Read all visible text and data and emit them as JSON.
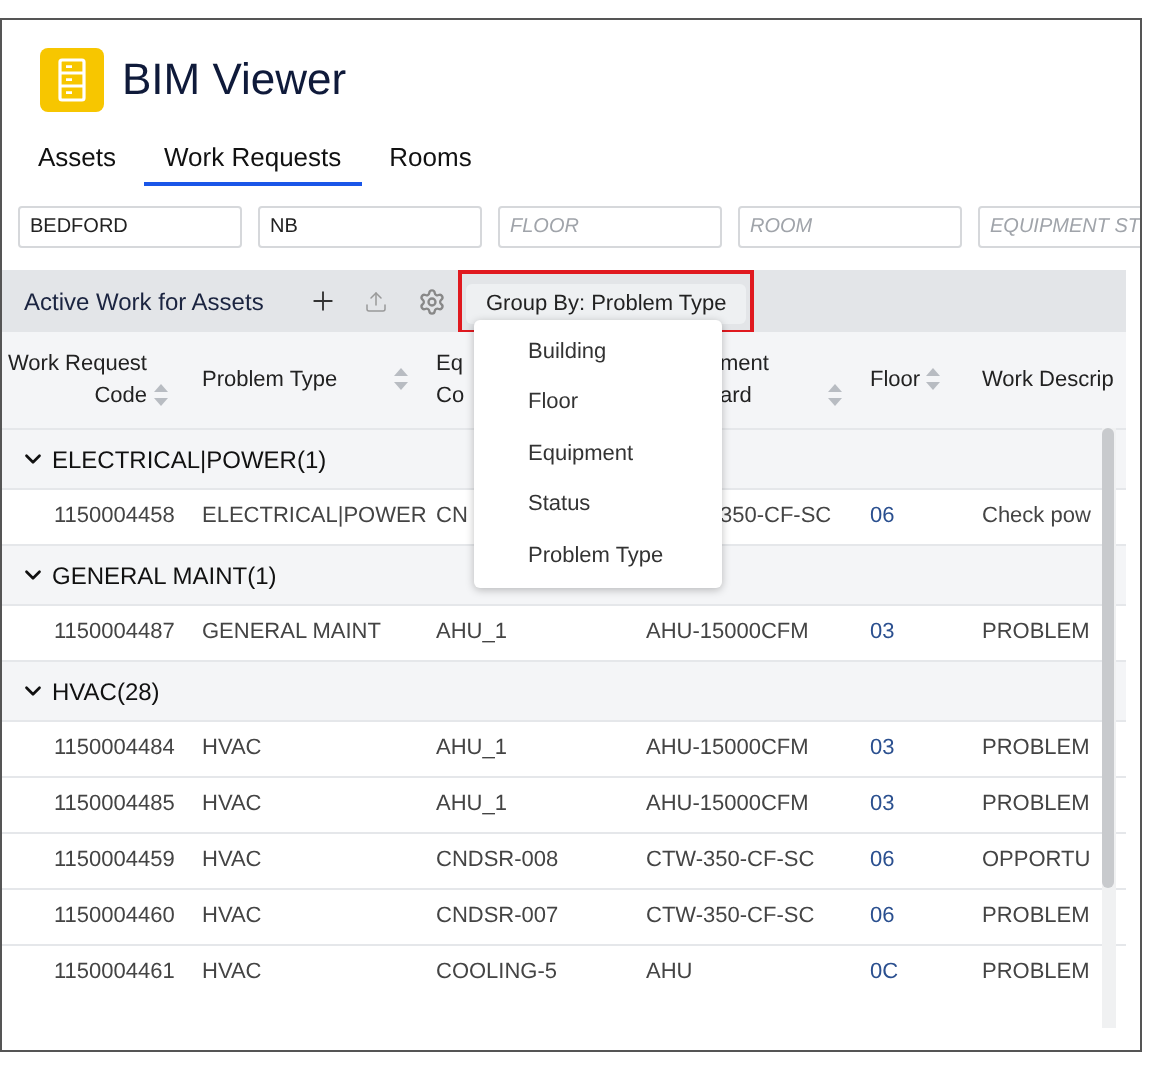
{
  "app": {
    "title": "BIM Viewer"
  },
  "tabs": [
    {
      "label": "Assets",
      "selected": false
    },
    {
      "label": "Work Requests",
      "selected": true
    },
    {
      "label": "Rooms",
      "selected": false
    }
  ],
  "filters": [
    {
      "value": "BEDFORD"
    },
    {
      "value": "NB"
    },
    {
      "placeholder": "FLOOR"
    },
    {
      "placeholder": "ROOM"
    },
    {
      "placeholder": "EQUIPMENT ST"
    }
  ],
  "panel": {
    "title": "Active Work for Assets",
    "group_by": {
      "label": "Group By: Problem Type",
      "highlighted": true,
      "expanded": true,
      "options": [
        "Building",
        "Floor",
        "Equipment",
        "Status",
        "Problem Type"
      ]
    }
  },
  "table": {
    "columns": [
      {
        "lines": [
          "Work Request",
          "Code"
        ],
        "sortable": true
      },
      {
        "lines": [
          "Problem Type"
        ],
        "sortable": true
      },
      {
        "lines": [
          "Eq",
          "Co"
        ],
        "sortable": false
      },
      {
        "lines": [
          "ment",
          "ard"
        ],
        "sortable": true,
        "under_menu": true
      },
      {
        "lines": [
          "Floor"
        ],
        "sortable": true
      },
      {
        "lines": [
          "Work Descrip"
        ],
        "sortable": false
      }
    ],
    "groups": [
      {
        "label": "ELECTRICAL|POWER(1)",
        "expanded": true,
        "rows": [
          {
            "cells": [
              "1150004458",
              "ELECTRICAL|POWER",
              "CN",
              "350-CF-SC",
              "06",
              "Check pow"
            ],
            "under_menu": true
          }
        ]
      },
      {
        "label": "GENERAL MAINT(1)",
        "expanded": true,
        "rows": [
          {
            "cells": [
              "1150004487",
              "GENERAL MAINT",
              "AHU_1",
              "AHU-15000CFM",
              "03",
              "PROBLEM"
            ],
            "under_menu": false
          }
        ]
      },
      {
        "label": "HVAC(28)",
        "expanded": true,
        "rows": [
          {
            "cells": [
              "1150004484",
              "HVAC",
              "AHU_1",
              "AHU-15000CFM",
              "03",
              "PROBLEM"
            ],
            "under_menu": false
          },
          {
            "cells": [
              "1150004485",
              "HVAC",
              "AHU_1",
              "AHU-15000CFM",
              "03",
              "PROBLEM"
            ],
            "under_menu": false
          },
          {
            "cells": [
              "1150004459",
              "HVAC",
              "CNDSR-008",
              "CTW-350-CF-SC",
              "06",
              "OPPORTU"
            ],
            "under_menu": false
          },
          {
            "cells": [
              "1150004460",
              "HVAC",
              "CNDSR-007",
              "CTW-350-CF-SC",
              "06",
              "PROBLEM"
            ],
            "under_menu": false
          },
          {
            "cells": [
              "1150004461",
              "HVAC",
              "COOLING-5",
              "AHU",
              "0C",
              "PROBLEM"
            ],
            "under_menu": false
          }
        ]
      }
    ]
  }
}
